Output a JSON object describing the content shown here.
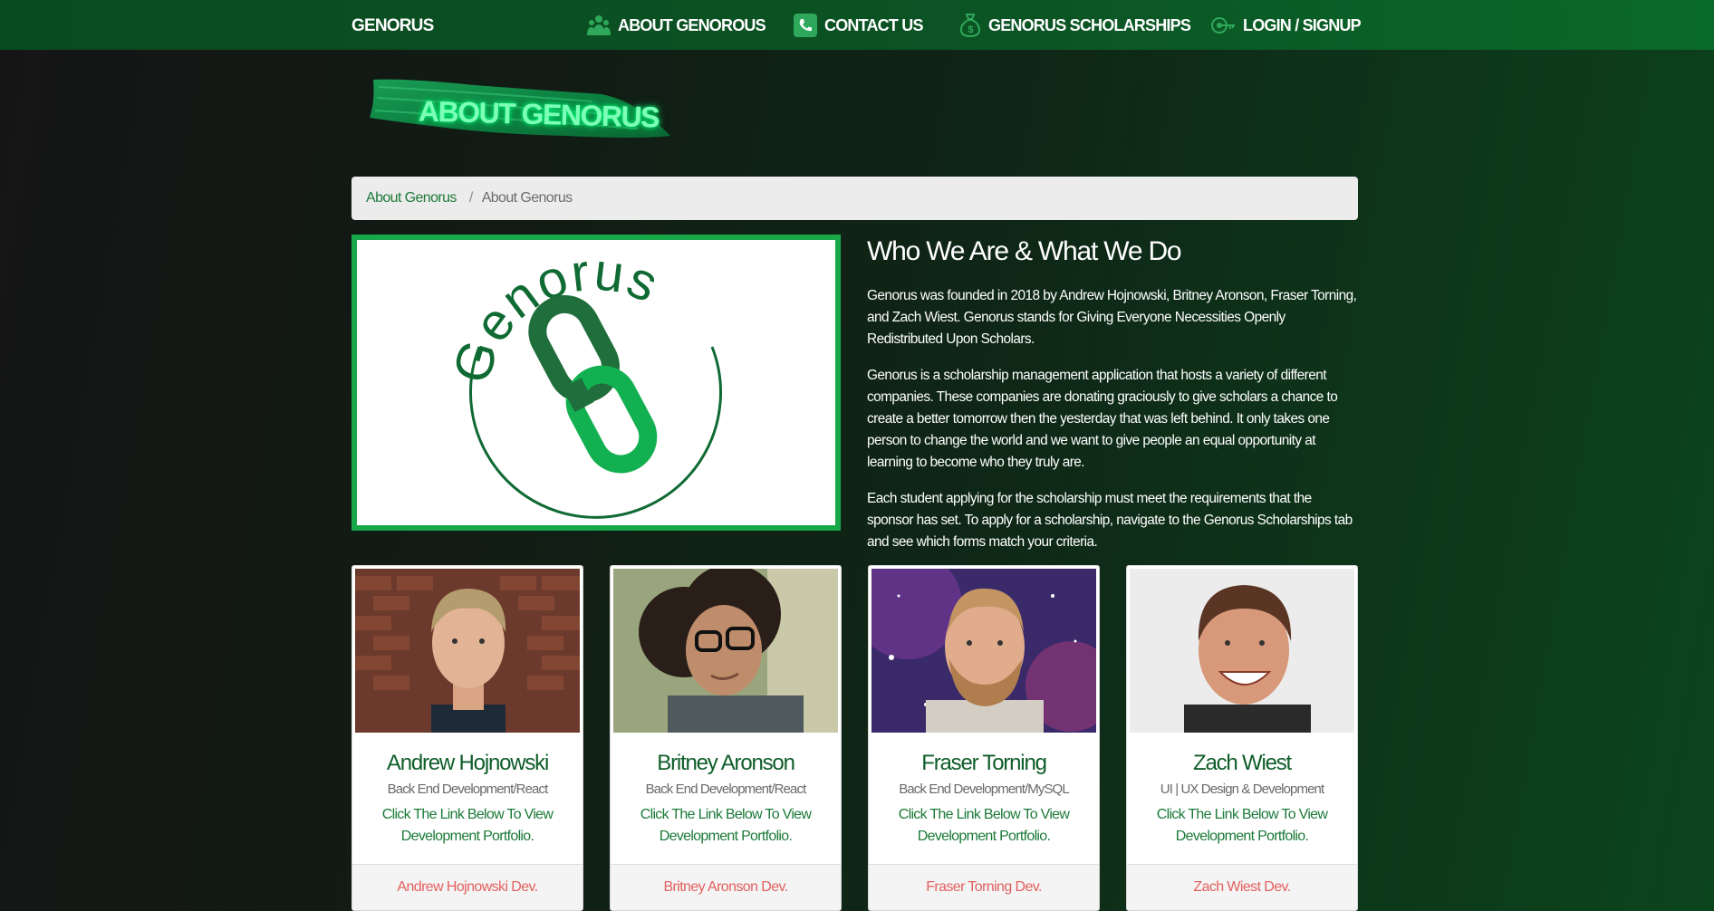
{
  "navbar": {
    "brand": "GENORUS",
    "items": [
      {
        "label": "ABOUT GENOROUS",
        "icon": "people-icon"
      },
      {
        "label": "CONTACT US",
        "icon": "phone-icon"
      },
      {
        "label": "GENORUS SCHOLARSHIPS",
        "icon": "money-bag-icon"
      },
      {
        "label": "LOGIN / SIGNUP",
        "icon": "key-icon"
      }
    ]
  },
  "banner": {
    "text": "ABOUT GENORUS"
  },
  "breadcrumb": {
    "link": "About Genorus",
    "separator": "/",
    "current": "About Genorus"
  },
  "logo": {
    "wordmark": "Genorus"
  },
  "about": {
    "heading": "Who We Are & What We Do",
    "paragraphs": [
      "Genorus was founded in 2018 by Andrew Hojnowski, Britney Aronson, Fraser Torning, and Zach Wiest. Genorus stands for Giving Everyone Necessities Openly Redistributed Upon Scholars.",
      "Genorus is a scholarship management application that hosts a variety of different companies. These companies are donating graciously to give scholars a chance to create a better tomorrow then the yesterday that was left behind. It only takes one person to change the world and we want to give people an equal opportunity at learning to become who they truly are.",
      "Each student applying for the scholarship must meet the requirements that the sponsor has set. To apply for a scholarship, navigate to the Genorus Scholarships tab and see which forms match your criteria."
    ]
  },
  "team": [
    {
      "name": "Andrew Hojnowski",
      "role": "Back End Development/React",
      "text": "Click The Link Below To View Development Portfolio.",
      "link": "Andrew Hojnowski Dev."
    },
    {
      "name": "Britney Aronson",
      "role": "Back End Development/React",
      "text": "Click The Link Below To View Development Portfolio.",
      "link": "Britney Aronson Dev."
    },
    {
      "name": "Fraser Torning",
      "role": "Back End Development/MySQL",
      "text": "Click The Link Below To View Development Portfolio.",
      "link": "Fraser Torning Dev."
    },
    {
      "name": "Zach Wiest",
      "role": "UI | UX Design & Development",
      "text": "Click The Link Below To View Development Portfolio.",
      "link": "Zach Wiest Dev."
    }
  ],
  "colors": {
    "brand_green": "#18a84a",
    "dark_green": "#0e5d29",
    "link_red": "#e2605e"
  }
}
